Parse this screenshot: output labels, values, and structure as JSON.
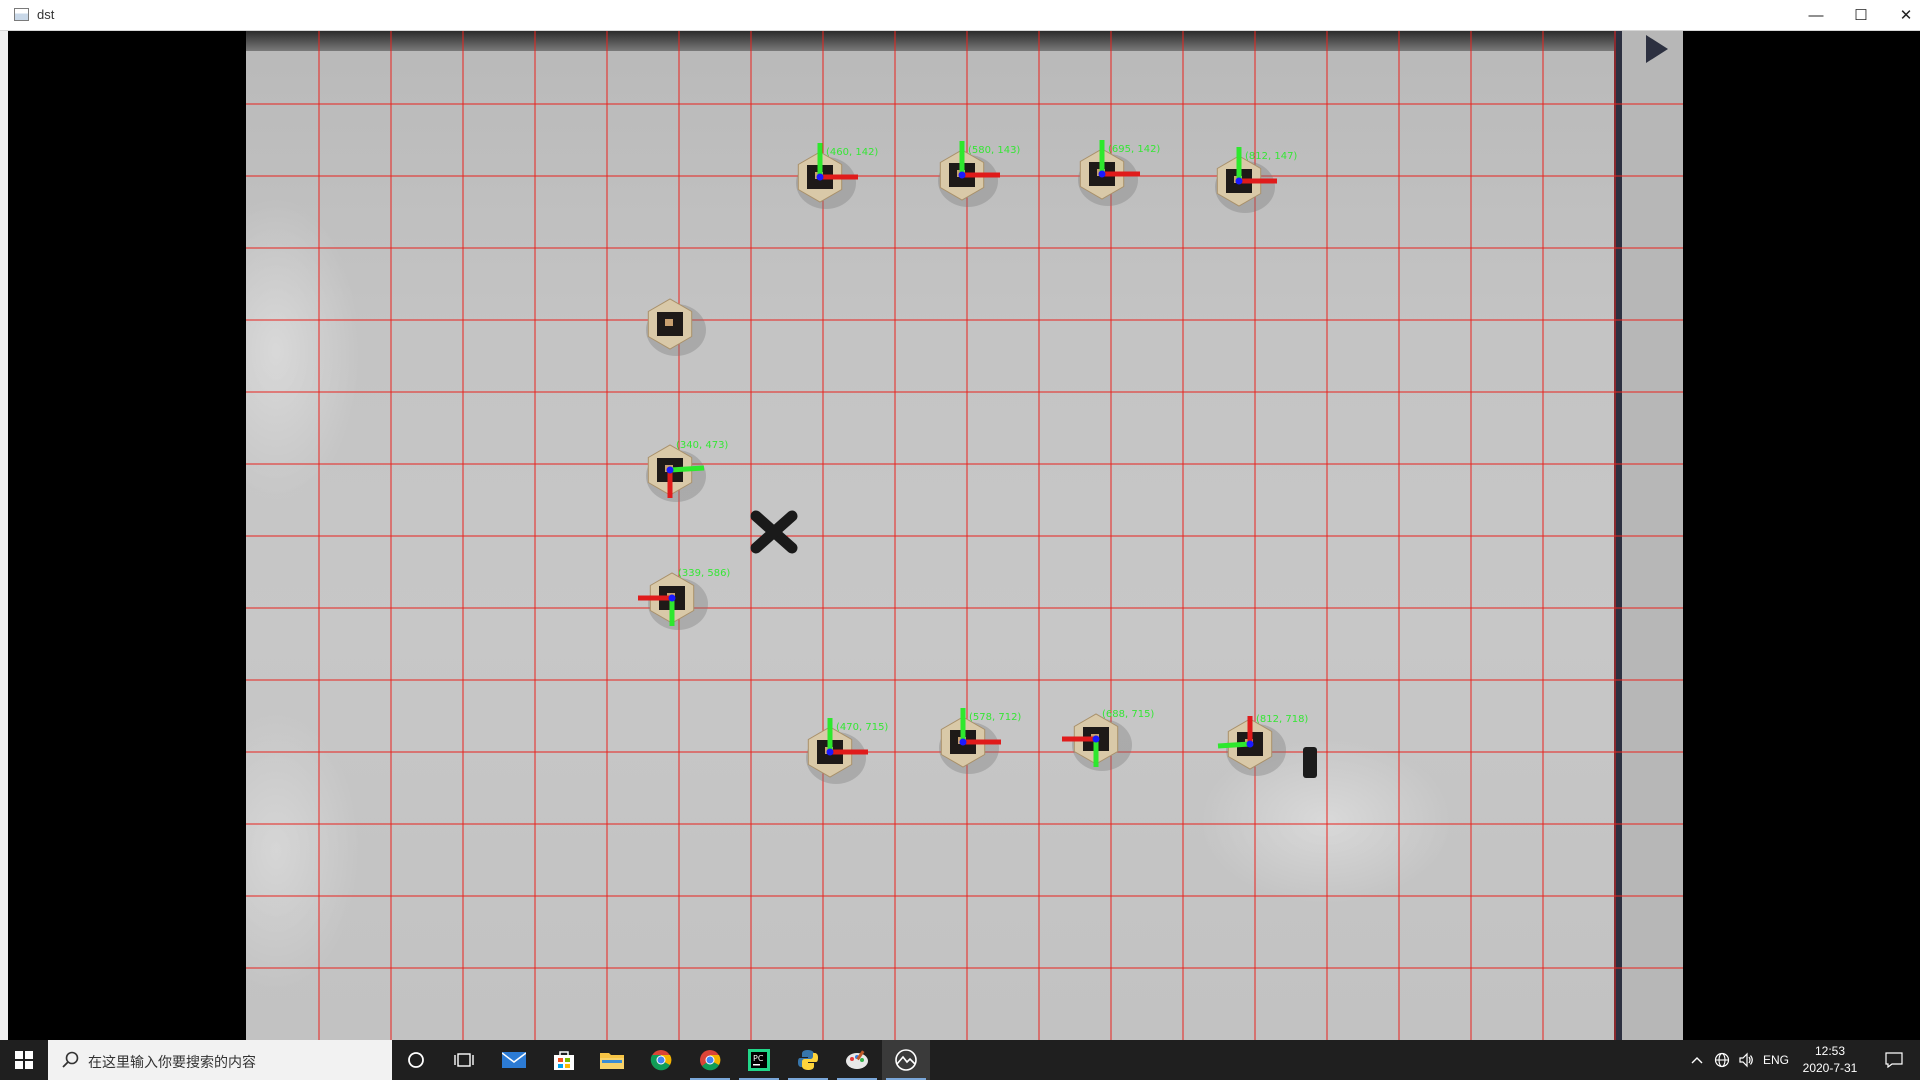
{
  "window": {
    "title": "dst",
    "buttons": {
      "minimize": "—",
      "maximize": "☐",
      "close": "✕"
    }
  },
  "image": {
    "markers": [
      {
        "id": "m1",
        "label": "(460, 142)",
        "axes": "up-right"
      },
      {
        "id": "m2",
        "label": "(580, 143)",
        "axes": "up-right"
      },
      {
        "id": "m3",
        "label": "(695, 142)",
        "axes": "up-right"
      },
      {
        "id": "m4",
        "label": "(812, 147)",
        "axes": "up-right"
      },
      {
        "id": "m5",
        "label": "",
        "axes": "none"
      },
      {
        "id": "m6",
        "label": "(340, 473)",
        "axes": "right-down"
      },
      {
        "id": "m7",
        "label": "(339, 586)",
        "axes": "left-down"
      },
      {
        "id": "m8",
        "label": "(470, 715)",
        "axes": "up-right"
      },
      {
        "id": "m9",
        "label": "(578, 712)",
        "axes": "up-right"
      },
      {
        "id": "m10",
        "label": "(688, 715)",
        "axes": "left-down"
      },
      {
        "id": "m11",
        "label": "(812, 718)",
        "axes": "left-up"
      }
    ],
    "grid_color": "#e8231e",
    "axis_colors": {
      "x": "#e01b1b",
      "y": "#2ee82e",
      "z": "#1a1aff"
    }
  },
  "taskbar": {
    "search_placeholder": "在这里输入你要搜索的内容",
    "apps": [
      {
        "name": "cortana-icon"
      },
      {
        "name": "task-view-icon"
      },
      {
        "name": "mail-icon"
      },
      {
        "name": "store-icon"
      },
      {
        "name": "file-explorer-icon"
      },
      {
        "name": "chrome-icon"
      },
      {
        "name": "chrome-icon-2"
      },
      {
        "name": "pycharm-icon"
      },
      {
        "name": "python-icon"
      },
      {
        "name": "paint-icon"
      },
      {
        "name": "opencv-window-icon"
      }
    ],
    "tray": {
      "language": "ENG",
      "time": "12:53",
      "date": "2020-7-31"
    }
  }
}
